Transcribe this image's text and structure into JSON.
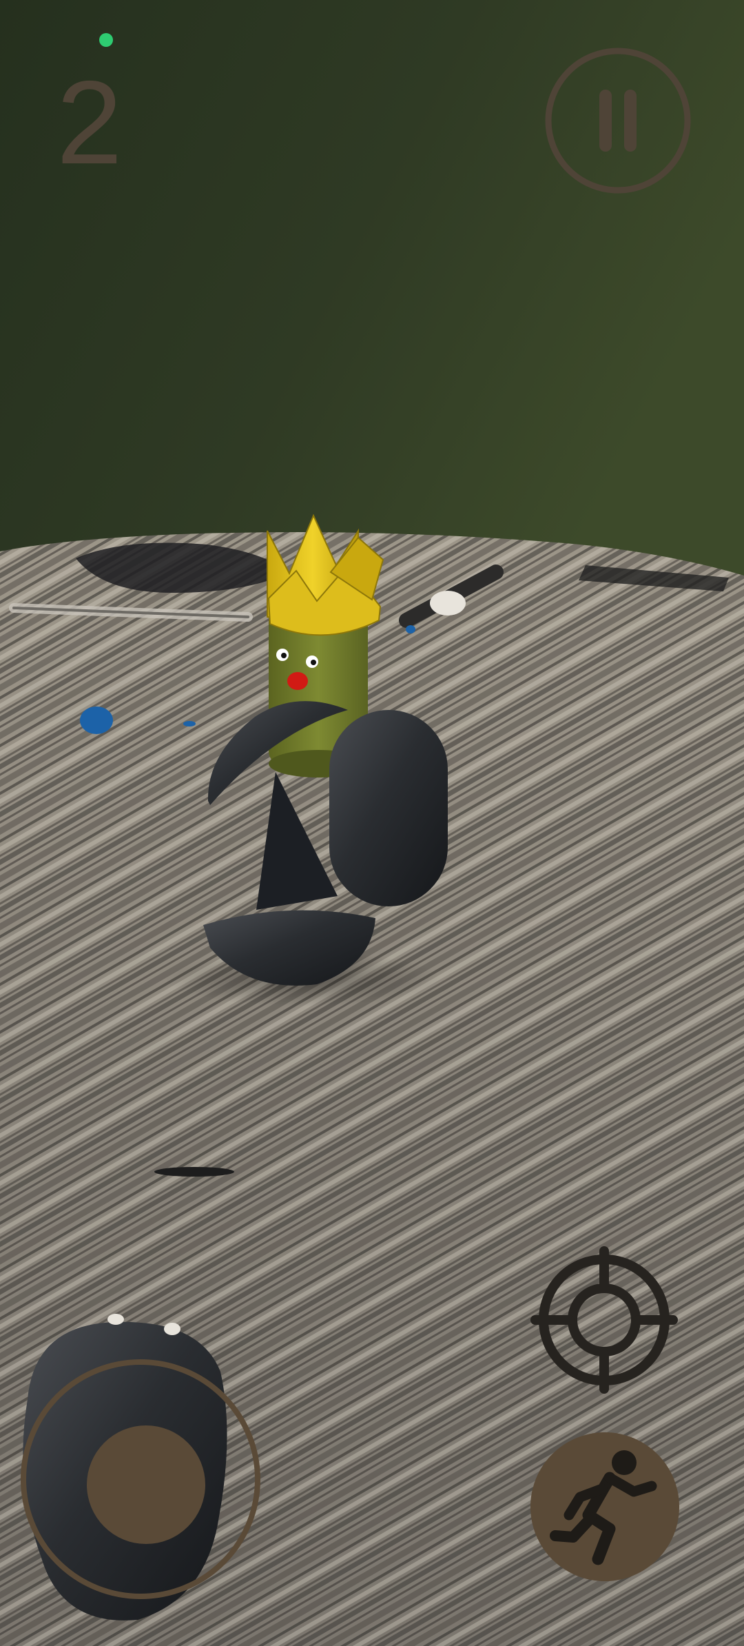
{
  "hud": {
    "score": "2",
    "status_dot_color": "#2ecc71",
    "hud_color": "#4f4437",
    "hud_fill": "#5a4a37"
  },
  "controls": {
    "pause_icon": "pause-icon",
    "aim_icon": "crosshair-icon",
    "run_icon": "running-figure-icon",
    "joystick": "virtual-joystick"
  },
  "scene": {
    "wall_color": "#2f3a24",
    "floor_color": "#8c8780",
    "character": {
      "crown_color": "#e2c31b",
      "body_color": "#6f7a2a",
      "nose_color": "#d11a14",
      "armor_color": "#24272c"
    }
  }
}
